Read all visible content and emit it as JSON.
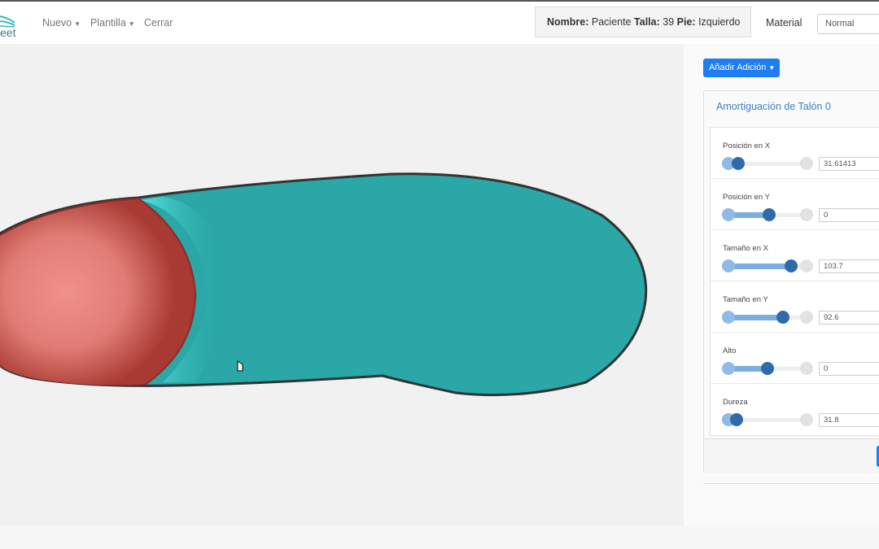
{
  "nav": {
    "brand": "eet",
    "items": [
      {
        "label": "Nuevo",
        "dropdown": true
      },
      {
        "label": "Plantilla",
        "dropdown": true
      },
      {
        "label": "Cerrar",
        "dropdown": false
      }
    ]
  },
  "info": {
    "name_label": "Nombre:",
    "name": "Paciente",
    "size_label": "Talla:",
    "size": "39",
    "foot_label": "Pie:",
    "foot": "Izquierdo"
  },
  "material": {
    "label": "Material",
    "value": "Normal"
  },
  "panel": {
    "add_button": "Añadir Adición",
    "card_title": "Amortiguación de Talón 0",
    "params": [
      {
        "label": "Posición en X",
        "value": "31.61413",
        "level": 0.13
      },
      {
        "label": "Posición en Y",
        "value": "0",
        "level": 0.52
      },
      {
        "label": "Tamaño en X",
        "value": "103.7",
        "level": 0.8
      },
      {
        "label": "Tamaño en Y",
        "value": "92.6",
        "level": 0.7
      },
      {
        "label": "Alto",
        "value": "0",
        "level": 0.5
      },
      {
        "label": "Dureza",
        "value": "31.8",
        "level": 0.1
      }
    ]
  },
  "colors": {
    "insole": "#2aa7a6",
    "heel_pad": "#a83a33",
    "accent": "#1e7df0"
  }
}
